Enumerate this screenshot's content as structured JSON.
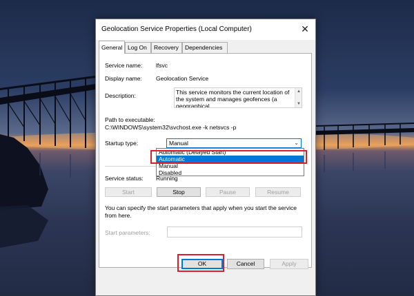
{
  "dialog": {
    "title": "Geolocation Service Properties (Local Computer)",
    "close_glyph": "✕"
  },
  "tabs": [
    {
      "label": "General",
      "active": true
    },
    {
      "label": "Log On",
      "active": false
    },
    {
      "label": "Recovery",
      "active": false
    },
    {
      "label": "Dependencies",
      "active": false
    }
  ],
  "general": {
    "service_name_label": "Service name:",
    "service_name_value": "lfsvc",
    "display_name_label": "Display name:",
    "display_name_value": "Geolocation Service",
    "description_label": "Description:",
    "description_value": "This service monitors the current location of the system and manages geofences (a geographical",
    "path_label": "Path to executable:",
    "path_value": "C:\\WINDOWS\\system32\\svchost.exe -k netsvcs -p",
    "startup_type_label": "Startup type:",
    "startup_type_value": "Manual",
    "startup_options": [
      {
        "label": "Automatic (Delayed Start)",
        "selected": false
      },
      {
        "label": "Automatic",
        "selected": true
      },
      {
        "label": "Manual",
        "selected": false
      },
      {
        "label": "Disabled",
        "selected": false
      }
    ],
    "service_status_label": "Service status:",
    "service_status_value": "Running",
    "buttons": {
      "start": "Start",
      "stop": "Stop",
      "pause": "Pause",
      "resume": "Resume"
    },
    "params_note": "You can specify the start parameters that apply when you start the service from here.",
    "start_params_label": "Start parameters:",
    "start_params_value": ""
  },
  "footer": {
    "ok": "OK",
    "cancel": "Cancel",
    "apply": "Apply"
  },
  "colors": {
    "highlight_border": "#d8202b",
    "selection_blue": "#0078d7"
  },
  "icons": {
    "close": "close-icon",
    "dropdown": "chevron-down-icon",
    "scroll_up": "scroll-up-icon",
    "scroll_down": "scroll-down-icon"
  }
}
